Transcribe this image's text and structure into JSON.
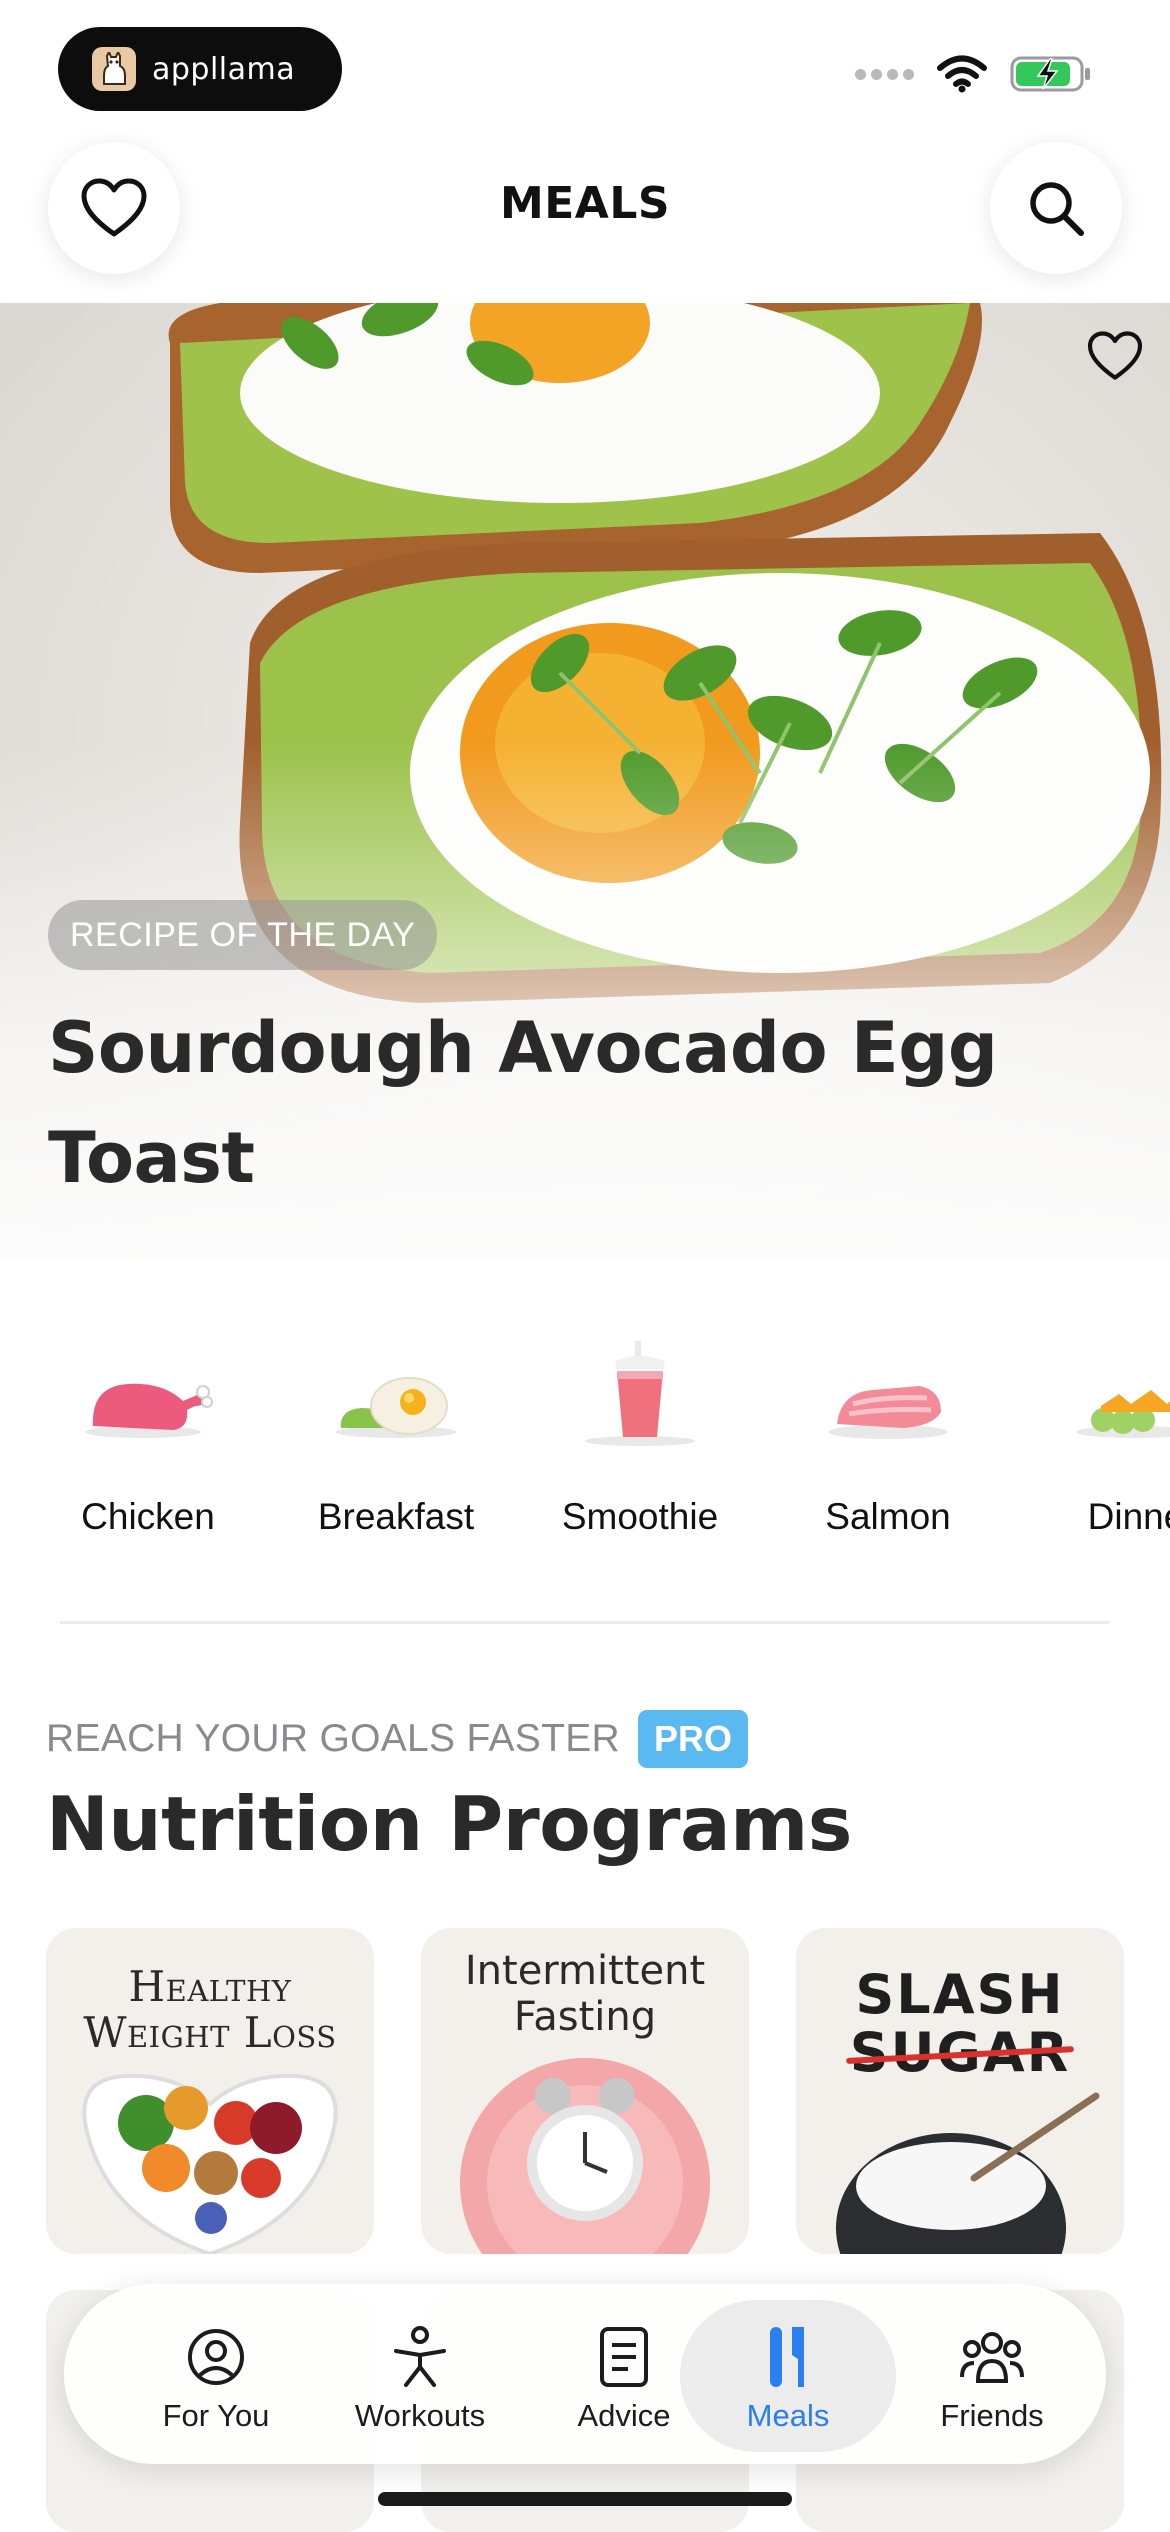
{
  "status_bar": {
    "app_badge_label": "appllama"
  },
  "header": {
    "title": "MEALS",
    "favorite_icon": "heart-icon",
    "search_icon": "search-icon"
  },
  "hero": {
    "badge": "RECIPE OF THE DAY",
    "title": "Sourdough Avocado Egg Toast",
    "favorite_icon": "heart-icon"
  },
  "categories": [
    {
      "label": "Chicken",
      "icon": "chicken-icon"
    },
    {
      "label": "Breakfast",
      "icon": "breakfast-icon"
    },
    {
      "label": "Smoothie",
      "icon": "smoothie-icon"
    },
    {
      "label": "Salmon",
      "icon": "salmon-icon"
    },
    {
      "label": "Dinne",
      "icon": "dinner-icon"
    }
  ],
  "programs": {
    "kicker": "REACH YOUR GOALS FASTER",
    "pro_badge": "PRO",
    "title": "Nutrition Programs",
    "cards": [
      {
        "title_line1": "Healthy",
        "title_line2": "Weight Loss"
      },
      {
        "title_line1": "Intermittent",
        "title_line2": "Fasting"
      },
      {
        "title_line1": "SLASH",
        "title_line2": "SUGAR"
      }
    ]
  },
  "tab_bar": {
    "tabs": [
      {
        "label": "For You",
        "icon": "person-circle-icon",
        "active": false
      },
      {
        "label": "Workouts",
        "icon": "figure-icon",
        "active": false
      },
      {
        "label": "Advice",
        "icon": "document-icon",
        "active": false
      },
      {
        "label": "Meals",
        "icon": "fork-knife-icon",
        "active": true
      },
      {
        "label": "Friends",
        "icon": "group-icon",
        "active": false
      }
    ]
  },
  "colors": {
    "accent": "#2a7ef0",
    "pro_badge": "#59b9f0",
    "strike": "#d8322f"
  }
}
